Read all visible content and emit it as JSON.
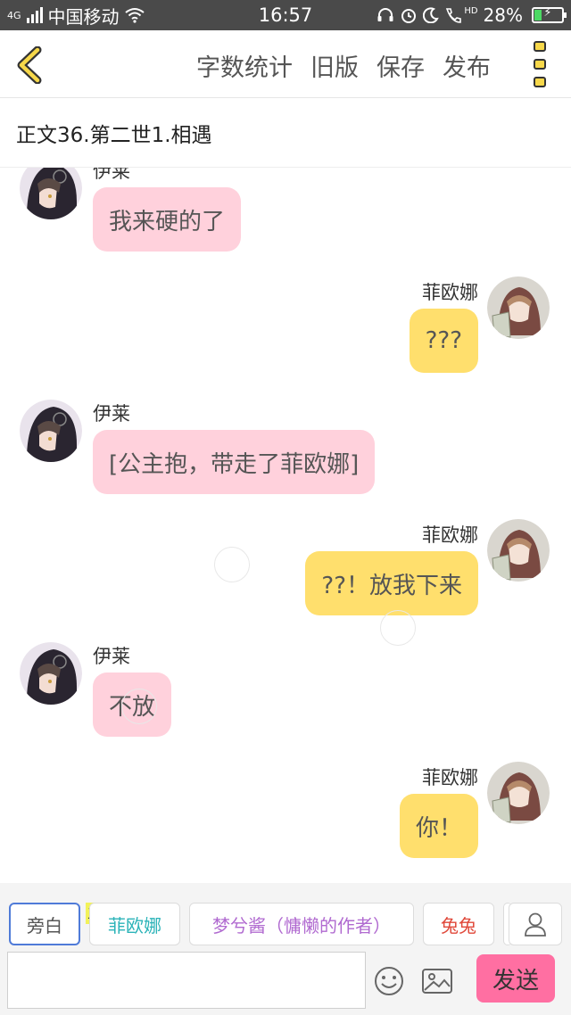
{
  "status_bar": {
    "network_label": "4G",
    "carrier": "中国移动",
    "time": "16:57",
    "hd_label": "HD",
    "battery": "28%",
    "battery_level": 0.28
  },
  "header": {
    "menu": [
      "字数统计",
      "旧版",
      "保存",
      "发布"
    ],
    "chapter_title": "正文36.第二世1.相遇"
  },
  "characters": {
    "yilai": "伊莱",
    "feiouna": "菲欧娜"
  },
  "messages": [
    {
      "speaker": "伊莱",
      "side": "left",
      "text": "我来硬的了"
    },
    {
      "speaker": "菲欧娜",
      "side": "right",
      "text": "???"
    },
    {
      "speaker": "伊莱",
      "side": "left",
      "text": "[公主抱，带走了菲欧娜]"
    },
    {
      "speaker": "菲欧娜",
      "side": "right",
      "text": "??！放我下来"
    },
    {
      "speaker": "伊莱",
      "side": "left",
      "text": "不放"
    },
    {
      "speaker": "菲欧娜",
      "side": "right",
      "text": "你！"
    }
  ],
  "roles": {
    "narration": "旁白",
    "main_tag": "主",
    "items": [
      {
        "label": "菲欧娜",
        "color": "#2bb3b8"
      },
      {
        "label": "梦兮酱（慵懒的作者）",
        "color": "#b06ad0"
      },
      {
        "label": "兔兔",
        "color": "#e0483a"
      }
    ]
  },
  "input": {
    "value": "",
    "send_label": "发送"
  },
  "colors": {
    "left_bubble": "#ffd1dc",
    "right_bubble": "#ffdf6d",
    "send_button": "#ff6fa2",
    "accent": "#f7d84a"
  },
  "icons": [
    "back-arrow-icon",
    "more-icon",
    "emoji-icon",
    "image-icon",
    "user-icon",
    "wifi-icon",
    "alarm-icon",
    "moon-icon",
    "phone-icon",
    "headset-icon"
  ]
}
